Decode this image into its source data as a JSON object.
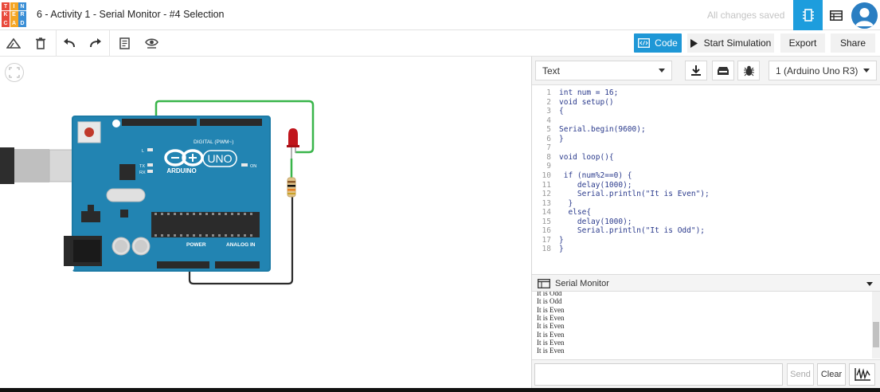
{
  "app": {
    "logo_letters": [
      "T",
      "I",
      "N",
      "K",
      "E",
      "R",
      "C",
      "A",
      "D"
    ],
    "logo_colors": [
      "#e84a3c",
      "#f5a623",
      "#3b8fd6",
      "#e84a3c",
      "#f5a623",
      "#3b8fd6",
      "#e84a3c",
      "#f5a623",
      "#3b8fd6"
    ],
    "design_title": "6 - Activity 1 - Serial Monitor - #4 Selection",
    "save_status": "All changes saved",
    "accent": "#1e97d6"
  },
  "toolbar": {
    "icons": [
      "rotate-icon",
      "trash-icon",
      "undo-icon",
      "redo-icon",
      "notes-icon",
      "eye-icon"
    ],
    "code_label": "Code",
    "simulate_label": "Start Simulation",
    "export_label": "Export",
    "share_label": "Share"
  },
  "code_editor": {
    "mode": "Text",
    "board": "1 (Arduino Uno R3)",
    "lines": [
      {
        "n": "1",
        "text": "int num = 16;"
      },
      {
        "n": "2",
        "text": "void setup()"
      },
      {
        "n": "3",
        "text": "{"
      },
      {
        "n": "4",
        "text": ""
      },
      {
        "n": "5",
        "text": "Serial.begin(9600);"
      },
      {
        "n": "6",
        "text": "}"
      },
      {
        "n": "7",
        "text": ""
      },
      {
        "n": "8",
        "text": "void loop(){"
      },
      {
        "n": "9",
        "text": ""
      },
      {
        "n": "10",
        "text": " if (num%2==0) {"
      },
      {
        "n": "11",
        "text": "    delay(1000);"
      },
      {
        "n": "12",
        "text": "    Serial.println(\"It is Even\");"
      },
      {
        "n": "13",
        "text": "  }"
      },
      {
        "n": "14",
        "text": "  else{"
      },
      {
        "n": "15",
        "text": "    delay(1000);"
      },
      {
        "n": "16",
        "text": "    Serial.println(\"It is Odd\");"
      },
      {
        "n": "17",
        "text": "}"
      },
      {
        "n": "18",
        "text": "}"
      }
    ]
  },
  "serial_monitor": {
    "title": "Serial Monitor",
    "output": [
      "It is Odd",
      "It is Odd",
      "It is Even",
      "It is Even",
      "It is Even",
      "It is Even",
      "It is Even",
      "It is Even"
    ],
    "input_value": "",
    "send_label": "Send",
    "clear_label": "Clear"
  },
  "board_labels": {
    "digital": "DIGITAL (PWM~)",
    "brand": "ARDUINO",
    "model": "UNO",
    "power": "POWER",
    "analog": "ANALOG IN",
    "on": "ON",
    "l": "L",
    "tx": "TX",
    "rx": "RX"
  }
}
